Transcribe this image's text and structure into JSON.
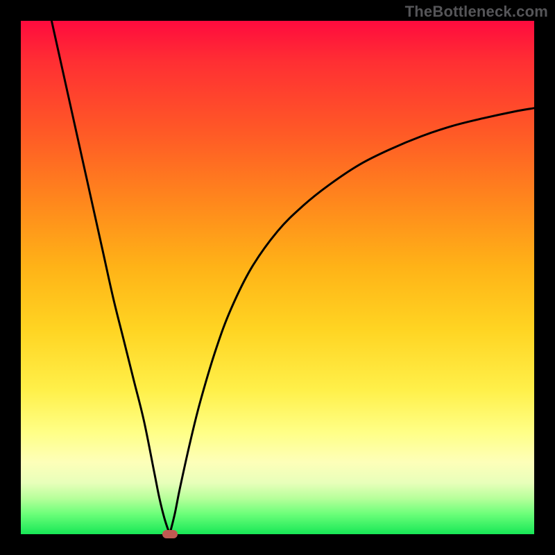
{
  "watermark": "TheBottleneck.com",
  "chart_data": {
    "type": "line",
    "title": "",
    "xlabel": "",
    "ylabel": "",
    "xlim": [
      0,
      100
    ],
    "ylim": [
      0,
      100
    ],
    "grid": false,
    "legend": false,
    "annotations": [],
    "minimum_marker": {
      "x": 29,
      "y": 0,
      "color": "#c05a52"
    },
    "series": [
      {
        "name": "curve-left",
        "x": [
          6,
          8,
          10,
          12,
          14,
          16,
          18,
          20,
          22,
          24,
          26,
          27,
          28,
          29
        ],
        "y": [
          100,
          91,
          82,
          73,
          64,
          55,
          46,
          38,
          30,
          22,
          12,
          7,
          3,
          0
        ]
      },
      {
        "name": "curve-right",
        "x": [
          29,
          30,
          31,
          33,
          35,
          38,
          41,
          45,
          50,
          55,
          60,
          66,
          72,
          78,
          84,
          90,
          96,
          100
        ],
        "y": [
          0,
          4,
          9,
          18,
          26,
          36,
          44,
          52,
          59,
          64,
          68,
          72,
          75,
          77.5,
          79.5,
          81,
          82.3,
          83
        ]
      }
    ],
    "background_gradient": {
      "direction": "top-to-bottom",
      "stops": [
        {
          "pos": 0,
          "color": "#ff0b3e"
        },
        {
          "pos": 22,
          "color": "#ff5a26"
        },
        {
          "pos": 48,
          "color": "#ffb317"
        },
        {
          "pos": 72,
          "color": "#fff04a"
        },
        {
          "pos": 90,
          "color": "#e8ffba"
        },
        {
          "pos": 100,
          "color": "#17e756"
        }
      ]
    }
  }
}
